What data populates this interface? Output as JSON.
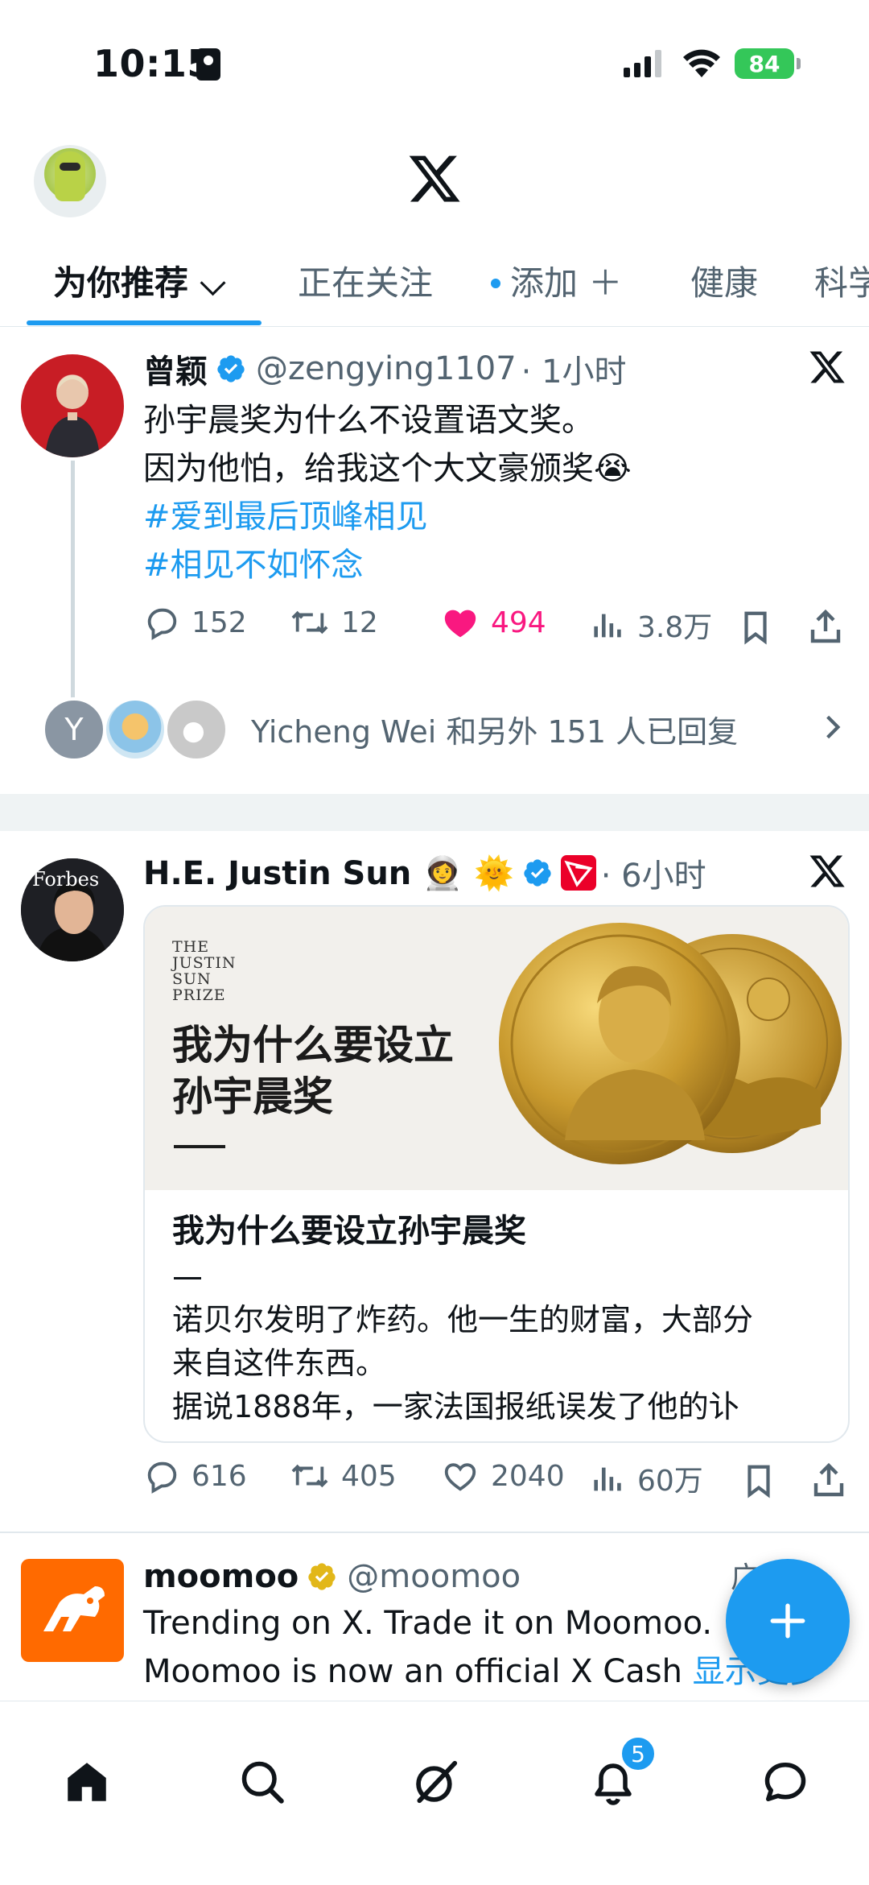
{
  "status_bar": {
    "time": "10:15",
    "battery": "84"
  },
  "tabs": [
    {
      "label": "为你推荐 ⌵",
      "active": true
    },
    {
      "label": "正在关注"
    },
    {
      "label": "添加 ＋"
    },
    {
      "label": "健康"
    },
    {
      "label": "科学"
    }
  ],
  "tweet1": {
    "name": "曾颖",
    "handle": "@zengying1107",
    "time": "· 1小时",
    "text_line1": "孙宇晨奖为什么不设置语文奖。",
    "text_line2": "因为他怕，给我这个大文豪颁奖😭",
    "hashtag1": "#爱到最后顶峰相见",
    "hashtag2": "#相见不如怀念",
    "replies": "152",
    "retweets": "12",
    "likes": "494",
    "views": "3.8万",
    "reply_summary": "Yicheng Wei 和另外 151 人已回复",
    "reply_avatar_letter": "Y"
  },
  "tweet2": {
    "name": "H.E. Justin Sun 👩‍🚀 🌞",
    "time": "· 6小时",
    "avatar_text": "Forbes",
    "card": {
      "brand_line1": "THE",
      "brand_line2": "JUSTIN",
      "brand_line3": "SUN",
      "brand_line4": "PRIZE",
      "headline_line1": "我为什么要设立",
      "headline_line2": "孙宇晨奖",
      "title": "我为什么要设立孙宇晨奖",
      "desc_line1": "诺贝尔发明了炸药。他一生的财富，大部分",
      "desc_line2": "来自这件东西。",
      "desc_line3": "据说1888年，一家法国报纸误发了他的讣"
    },
    "replies": "616",
    "retweets": "405",
    "likes": "2040",
    "views": "60万"
  },
  "ad": {
    "name": "moomoo",
    "handle": "@moomoo",
    "tag": "广告",
    "text_line1": "Trending on X. Trade it on Moomoo.",
    "text_line2": "Moomoo is now an official X Cash ",
    "show_more": "显示更多"
  },
  "nav": {
    "notification_count": "5"
  },
  "colors": {
    "accent": "#1d9bf0",
    "like": "#f91880",
    "muted": "#536471",
    "brand_ad": "#ff6a00"
  }
}
